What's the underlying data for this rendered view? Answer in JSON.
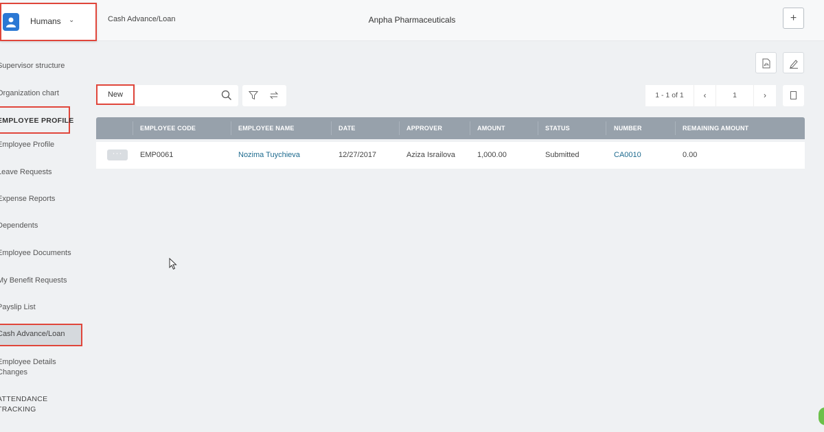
{
  "header": {
    "app_name": "Humans",
    "breadcrumb": "Cash Advance/Loan",
    "company": "Anpha Pharmaceuticals",
    "add_label": "+"
  },
  "sidebar": {
    "items": [
      {
        "label": "Supervisor structure"
      },
      {
        "label": "Organization chart"
      },
      {
        "label": "EMPLOYEE PROFILE"
      },
      {
        "label": "Employee Profile"
      },
      {
        "label": "Leave Requests"
      },
      {
        "label": "Expense Reports"
      },
      {
        "label": "Dependents"
      },
      {
        "label": "Employee Documents"
      },
      {
        "label": "My Benefit Requests"
      },
      {
        "label": "Payslip List"
      },
      {
        "label": "Cash Advance/Loan"
      },
      {
        "label": "Employee Details Changes"
      },
      {
        "label": "ATTENDANCE TRACKING"
      }
    ]
  },
  "toolbar": {
    "new_label": "New",
    "search_value": ""
  },
  "pager": {
    "info": "1 - 1 of 1",
    "page": "1"
  },
  "table": {
    "columns": [
      "EMPLOYEE CODE",
      "EMPLOYEE NAME",
      "DATE",
      "APPROVER",
      "AMOUNT",
      "STATUS",
      "NUMBER",
      "REMAINING AMOUNT"
    ],
    "rows": [
      {
        "menu": "···",
        "employee_code": "EMP0061",
        "employee_name": "Nozima Tuychieva",
        "date": "12/27/2017",
        "approver": "Aziza Israilova",
        "amount": "1,000.00",
        "status": "Submitted",
        "number": "CA0010",
        "remaining_amount": "0.00"
      }
    ]
  },
  "colors": {
    "accent": "#2b78d4",
    "highlight": "#e0453a",
    "header_bg": "#97a1ab",
    "link": "#1d6a8e"
  }
}
